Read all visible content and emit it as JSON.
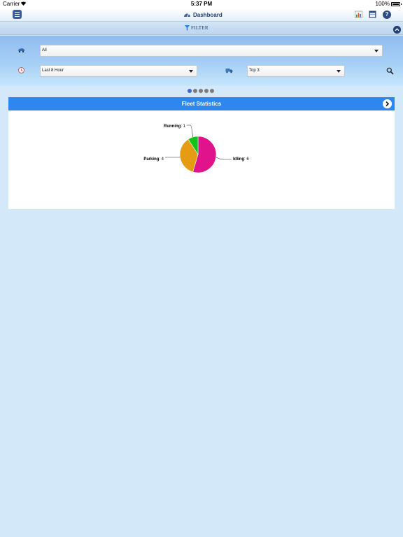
{
  "status_bar": {
    "carrier": "Carrier",
    "time": "5:37 PM",
    "battery": "100%"
  },
  "nav": {
    "title": "Dashboard",
    "help_label": "?",
    "icons": [
      "menu-icon",
      "speedometer-icon",
      "report-icon",
      "calendar-icon",
      "help-icon"
    ]
  },
  "filter": {
    "label": "FILTER",
    "vehicle_select": {
      "value": "All",
      "icon": "vehicle-icon"
    },
    "time_select": {
      "value": "Last 8 Hour",
      "icon": "clock-icon"
    },
    "top_select": {
      "value": "Top 3",
      "icon": "truck-icon"
    },
    "search_icon": "search-icon"
  },
  "pager": {
    "count": 5,
    "active_index": 0
  },
  "card": {
    "title": "Fleet Statistics"
  },
  "colors": {
    "accent": "#2d87f0",
    "idling": "#e0128c",
    "parking": "#e59c12",
    "running": "#14c21a",
    "page_bg": "#d3e8f8"
  },
  "chart_data": {
    "type": "pie",
    "slices": [
      {
        "label": "Idling",
        "value": 6,
        "color": "#e0128c"
      },
      {
        "label": "Parking",
        "value": 4,
        "color": "#e59c12"
      },
      {
        "label": "Running",
        "value": 1,
        "color": "#14c21a"
      }
    ]
  }
}
